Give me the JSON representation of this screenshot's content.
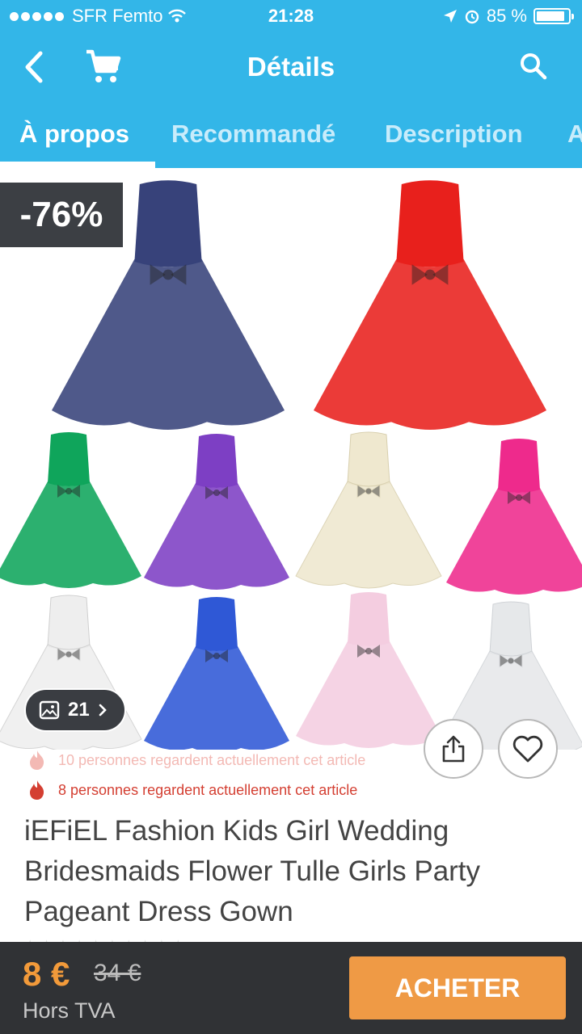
{
  "status_bar": {
    "carrier": "SFR Femto",
    "time": "21:28",
    "battery": "85 %"
  },
  "nav": {
    "title": "Détails",
    "back_icon": "chevron-left-icon",
    "cart_icon": "cart-icon",
    "search_icon": "search-icon"
  },
  "tabs": [
    {
      "label": "À propos",
      "active": true
    },
    {
      "label": "Recommandé",
      "active": false
    },
    {
      "label": "Description",
      "active": false
    },
    {
      "label": "A",
      "active": false
    }
  ],
  "product": {
    "discount": "-76%",
    "gallery_count": "21",
    "dress_colors": {
      "navy": "#37427a",
      "red": "#e8201c",
      "green": "#0fa55b",
      "purple": "#7d3fc4",
      "ivory": "#f5f0dc",
      "pink": "#ee2a8c",
      "white": "#f6f6f6",
      "royal_blue": "#2f58d6",
      "light_pink": "#f4cde0",
      "grey_white": "#eef0f2"
    },
    "watchers": [
      "10 personnes regardent actuellement cet article",
      "8 personnes regardent actuellement cet article"
    ],
    "title": "iEFiEL Fashion Kids Girl Wedding Bridesmaids Flower Tulle Girls Party Pageant Dress Gown"
  },
  "bottom_bar": {
    "price": "8 €",
    "old_price": "34 €",
    "tax_label": "Hors TVA",
    "buy_label": "ACHETER"
  },
  "colors": {
    "header_blue": "#33b6e8",
    "bottom_bar": "#303235",
    "accent_orange": "#ef9a45",
    "fire_red": "#d43f32"
  }
}
